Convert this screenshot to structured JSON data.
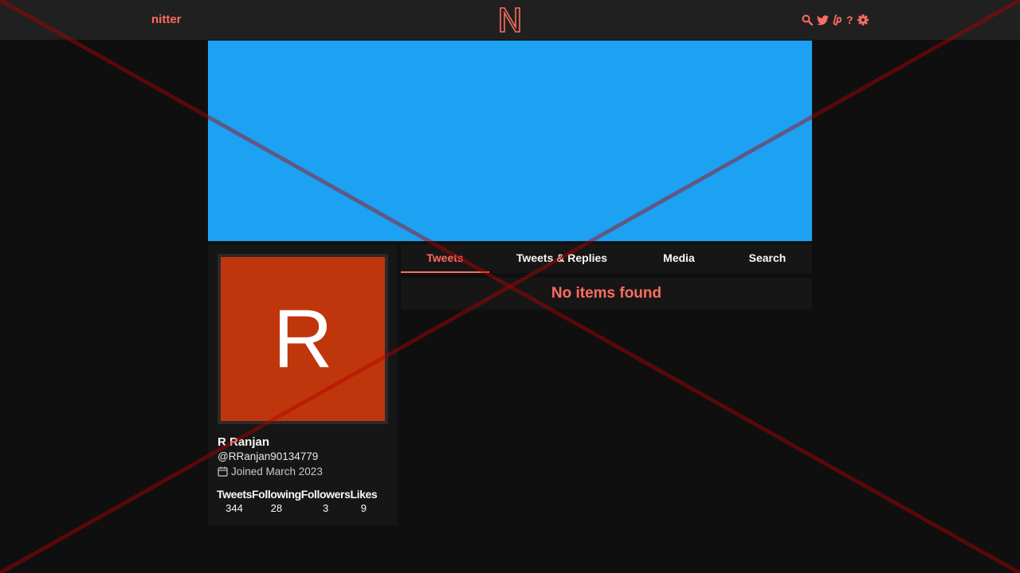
{
  "navbar": {
    "brand": "nitter",
    "logo_letter": "N",
    "icons": [
      "search-icon",
      "twitter-bird-icon",
      "liberapay-icon",
      "help-icon",
      "gear-icon"
    ],
    "help_glyph": "?"
  },
  "banner": {
    "color": "#1da1f2"
  },
  "profile": {
    "avatar_initial": "R",
    "avatar_color": "#bf360c",
    "fullname": "R Ranjan",
    "username": "@RRanjan90134779",
    "joined": "Joined March 2023",
    "stats": [
      {
        "label": "Tweets",
        "value": "344"
      },
      {
        "label": "Following",
        "value": "28"
      },
      {
        "label": "Followers",
        "value": "3"
      },
      {
        "label": "Likes",
        "value": "9"
      }
    ]
  },
  "tabs": [
    {
      "label": "Tweets",
      "active": true
    },
    {
      "label": "Tweets & Replies",
      "active": false
    },
    {
      "label": "Media",
      "active": false
    },
    {
      "label": "Search",
      "active": false
    }
  ],
  "timeline": {
    "empty_message": "No items found"
  },
  "colors": {
    "accent": "#ff6c60",
    "background": "#0f0f0f",
    "panel": "#161616",
    "navbar": "#202020"
  }
}
